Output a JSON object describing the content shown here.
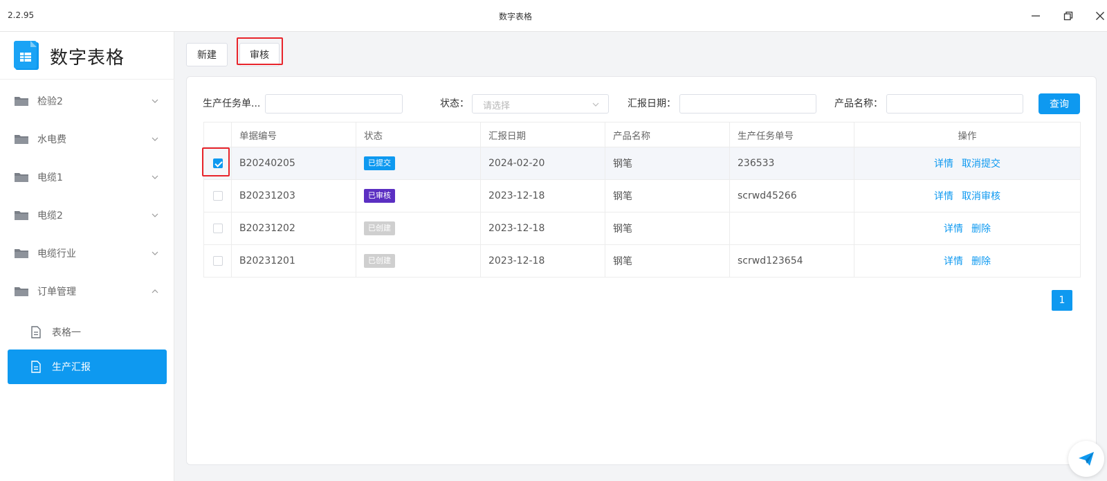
{
  "window": {
    "version": "2.2.95",
    "title": "数字表格"
  },
  "sidebar": {
    "brand": "数字表格",
    "items": [
      {
        "label": "检验2",
        "expanded": false
      },
      {
        "label": "水电费",
        "expanded": false
      },
      {
        "label": "电缆1",
        "expanded": false
      },
      {
        "label": "电缆2",
        "expanded": false
      },
      {
        "label": "电缆行业",
        "expanded": false
      },
      {
        "label": "订单管理",
        "expanded": true
      }
    ],
    "sub_items": [
      {
        "label": "表格一",
        "active": false
      },
      {
        "label": "生产汇报",
        "active": true
      }
    ]
  },
  "toolbar": {
    "new_label": "新建",
    "review_label": "审核"
  },
  "filters": {
    "task_label": "生产任务单...",
    "status_label": "状态：",
    "status_placeholder": "请选择",
    "date_label": "汇报日期：",
    "product_label": "产品名称：",
    "query_label": "查询"
  },
  "table": {
    "headers": [
      "单据编号",
      "状态",
      "汇报日期",
      "产品名称",
      "生产任务单号",
      "操作"
    ],
    "rows": [
      {
        "id": "B20240205",
        "status": "已提交",
        "date": "2024-02-20",
        "product": "钢笔",
        "task": "236533",
        "ops": [
          "详情",
          "取消提交"
        ],
        "checked": true
      },
      {
        "id": "B20231203",
        "status": "已审核",
        "date": "2023-12-18",
        "product": "钢笔",
        "task": "scrwd45266",
        "ops": [
          "详情",
          "取消审核"
        ],
        "checked": false
      },
      {
        "id": "B20231202",
        "status": "已创建",
        "date": "2023-12-18",
        "product": "钢笔",
        "task": "",
        "ops": [
          "详情",
          "删除"
        ],
        "checked": false
      },
      {
        "id": "B20231201",
        "status": "已创建",
        "date": "2023-12-18",
        "product": "钢笔",
        "task": "scrwd123654",
        "ops": [
          "详情",
          "删除"
        ],
        "checked": false
      }
    ]
  },
  "status_colors": {
    "已提交": "#0e99f0",
    "已审核": "#5b2fc2",
    "已创建": "#cfcfcf"
  },
  "pagination": {
    "current": "1"
  },
  "colors": {
    "accent": "#0e99f0",
    "highlight": "#e8242b"
  },
  "icons": {
    "fab": "paper-plane-icon"
  }
}
